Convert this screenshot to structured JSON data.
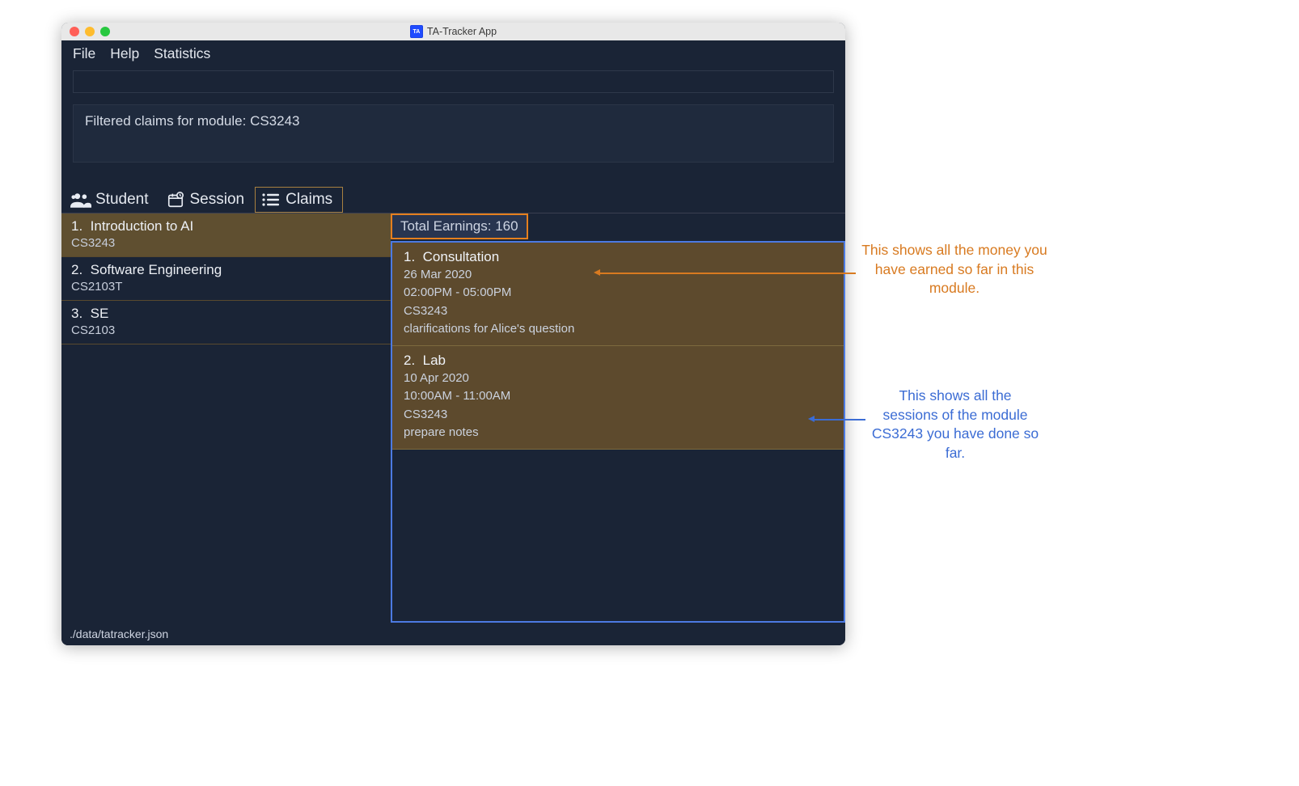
{
  "window": {
    "title": "TA-Tracker App",
    "badge": "TA"
  },
  "menubar": {
    "file": "File",
    "help": "Help",
    "stats": "Statistics"
  },
  "message": "Filtered claims for module: CS3243",
  "tabs": {
    "student": "Student",
    "session": "Session",
    "claims": "Claims",
    "active": "claims"
  },
  "modules": [
    {
      "idx": "1.",
      "name": "Introduction to AI",
      "code": "CS3243",
      "selected": true
    },
    {
      "idx": "2.",
      "name": "Software Engineering",
      "code": "CS2103T",
      "selected": false
    },
    {
      "idx": "3.",
      "name": "SE",
      "code": "CS2103",
      "selected": false
    }
  ],
  "earnings": {
    "label": "Total Earnings:",
    "value": "160"
  },
  "sessions": [
    {
      "idx": "1.",
      "type": "Consultation",
      "date": "26 Mar 2020",
      "time": "02:00PM - 05:00PM",
      "module": "CS3243",
      "note": "clarifications for Alice's question"
    },
    {
      "idx": "2.",
      "type": "Lab",
      "date": "10 Apr 2020",
      "time": "10:00AM - 11:00AM",
      "module": "CS3243",
      "note": "prepare notes"
    }
  ],
  "statusbar": "./data/tatracker.json",
  "annotations": {
    "earnings": "This shows all the money you have earned so far in this module.",
    "sessions": "This shows all the sessions of the module CS3243 you have done so far."
  }
}
